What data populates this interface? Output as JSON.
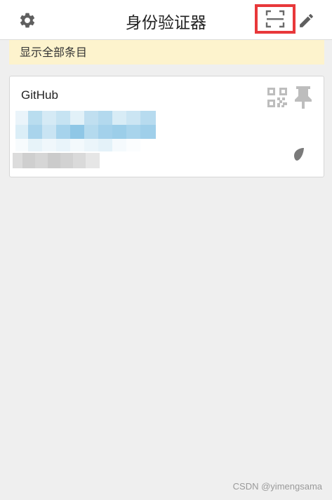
{
  "header": {
    "title": "身份验证器",
    "settings_icon": "gear-icon",
    "scan_icon": "scan-qr-icon",
    "edit_icon": "pencil-icon",
    "highlight_color": "#e8383a"
  },
  "notice": {
    "text": "显示全部条目",
    "background": "#fdf3cd"
  },
  "entries": [
    {
      "issuer": "GitHub",
      "code_hidden": true,
      "account_hidden": true,
      "qr_icon": "qr-code-icon",
      "pin_icon": "pin-icon",
      "timer_icon": "timer-icon"
    }
  ],
  "watermark": "CSDN @yimengsama"
}
